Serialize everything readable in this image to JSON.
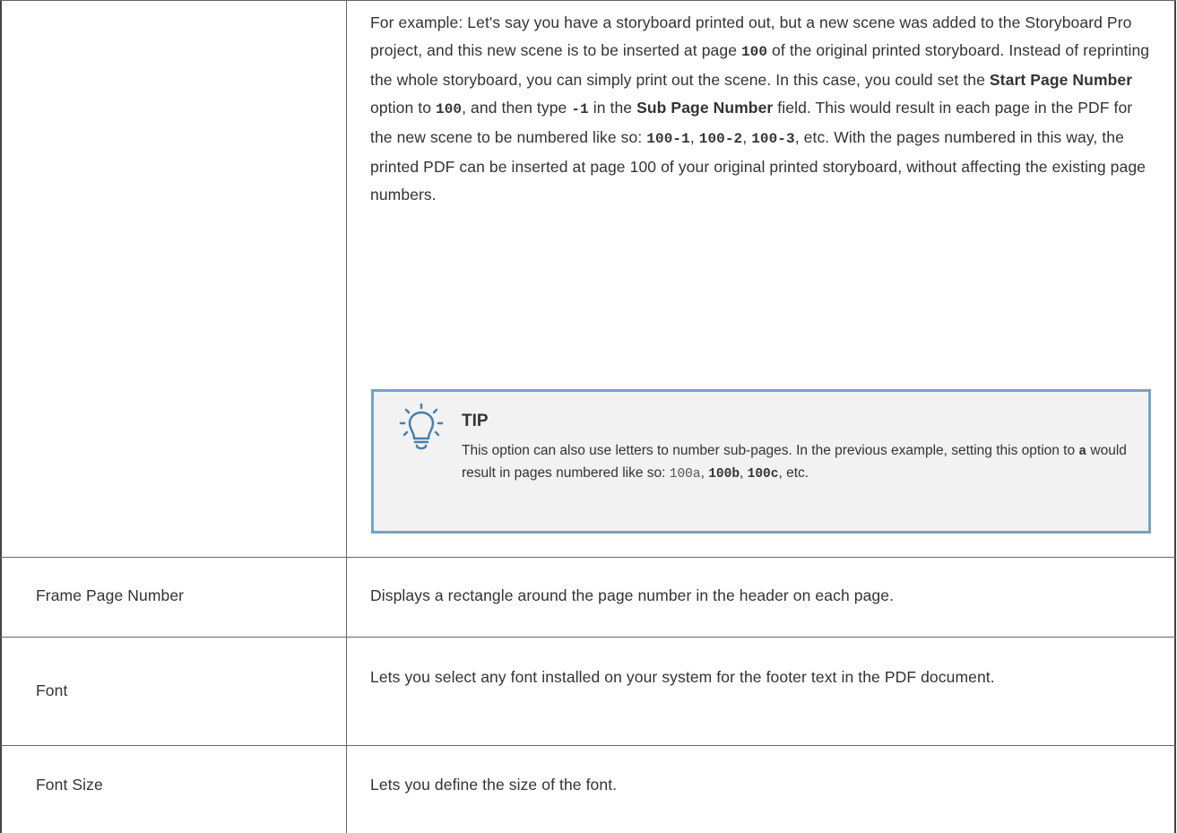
{
  "example_paragraph": {
    "s1": "For example: Let's say you have a storyboard printed out, but a new scene was added to the Storyboard Pro project, and this new scene is to be inserted at page ",
    "code1": "100",
    "s2": " of the original printed storyboard. Instead of reprinting the whole storyboard, you can simply print out the scene. In this case, you could set the ",
    "bold1": "Start Page Number",
    "s3": " option to ",
    "code2": "100",
    "s4": ", and then type ",
    "code3": "-1",
    "s5": " in the ",
    "bold2": "Sub Page Number",
    "s6": " field. This would result in each page in the PDF for the new scene to be numbered like so: ",
    "code4": "100-1",
    "s7": ", ",
    "code5": "100-2",
    "s8": ", ",
    "code6": "100-3",
    "s9": ", etc. With the pages numbered in this way, the printed PDF can be inserted at page 100 of your original printed storyboard, without affecting the existing page numbers."
  },
  "tip": {
    "title": "TIP",
    "s1": "This option can also use letters to number sub-pages. In the previous example, setting this option to ",
    "code1": "a",
    "s2": " would result in pages numbered like so: ",
    "code2": "100a",
    "s3": ", ",
    "code3": "100b",
    "s4": ", ",
    "code4": "100c",
    "s5": ", etc.",
    "icon": "lightbulb-icon"
  },
  "rows": [
    {
      "label": "Frame Page Number",
      "description": "Displays a rectangle around the page number in the header on each page."
    },
    {
      "label": "Font",
      "description": "Lets you select any font installed on your system for the footer text in the PDF document."
    },
    {
      "label": "Font Size",
      "description": "Lets you define the size of the font."
    }
  ],
  "colors": {
    "tip_border": "#74a3c6",
    "tip_background": "#f2f2f2",
    "text": "#333333"
  }
}
